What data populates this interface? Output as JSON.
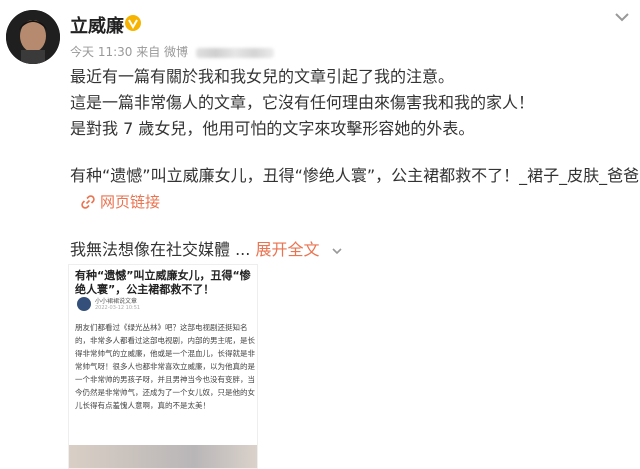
{
  "post": {
    "author": "立威廉",
    "meta": {
      "time": "今天 11:30",
      "source_label": "来自 微博"
    },
    "lines": [
      "最近有一篇有關於我和我女兒的文章引起了我的注意。",
      "這是一篇非常傷人的文章，它沒有任何理由來傷害我和我的家人！",
      "是對我 7 歲女兒，他用可怕的文字來攻擊形容她的外表。",
      "有种“遗憾”叫立威廉女儿，丑得“惨绝人寰”，公主裙都救不了！_裙子_皮肤_爸爸"
    ],
    "link_label": "网页链接",
    "truncated_text": "我無法想像在社交媒體 ...",
    "expand_label": "展开全文"
  },
  "screenshot": {
    "title": "有种“遗憾”叫立威廉女儿，丑得“惨绝人寰”，公主裙都救不了！",
    "author": "小小裙裙说文章",
    "subline": "2022-03-12 10:51",
    "paragraphs": [
      "朋友们都看过《绿光丛林》吧？这部电视剧还挺知名的，非常多人都看过这部电视剧，内部的男主呢，是长得非常帅气的立威廉，他或是一个混血儿，长得就是非常帅气呀！很多人也都非常喜欢立威廉，以为他真的是一个非常帅的男孩子呀，并且男神当今也没有变胖，当今仍然是非常帅气，还成为了一个女儿奴，只是他的女儿长得有点羞愧人意啊，真的不是太美！"
    ]
  },
  "colors": {
    "link": "#eb7350",
    "text": "#333333",
    "meta": "#999999"
  },
  "icons": {
    "verified": "verified-v-icon",
    "more": "chevron-down-icon",
    "link": "link-icon",
    "expand": "chevron-down-icon"
  }
}
